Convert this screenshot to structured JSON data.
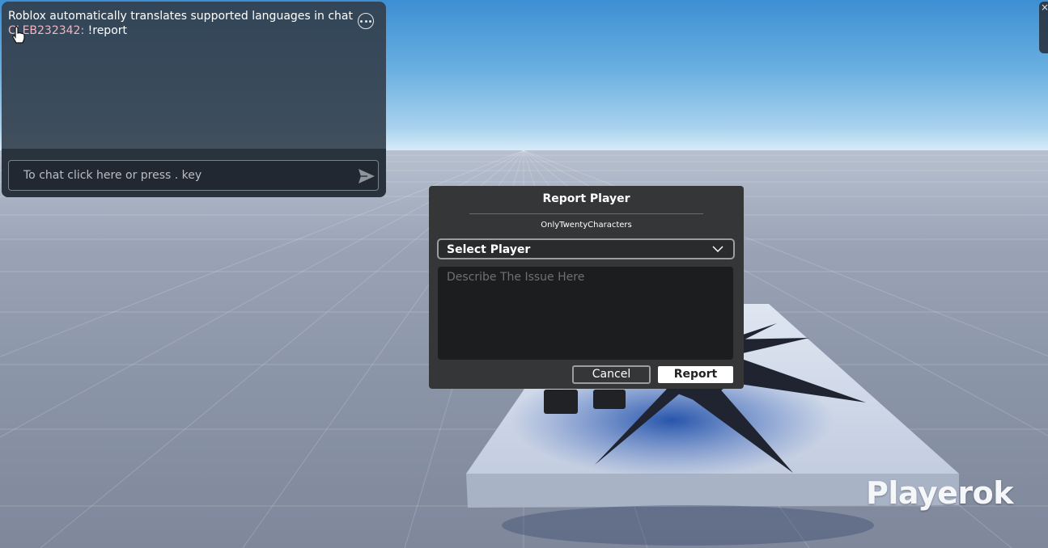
{
  "scene": {
    "sky_color": "#68aee0",
    "floor_color": "#8a94a7",
    "watermark": "Playerok"
  },
  "chat": {
    "lines": [
      {
        "text": "Roblox automatically translates supported languages in chat"
      },
      {
        "name": "CLEB232342:",
        "message": " !report"
      }
    ],
    "input_placeholder": "To chat click here or press . key",
    "icons": {
      "more": "more-options-icon",
      "send": "send-icon",
      "cursor": "hand-cursor-icon"
    }
  },
  "report_dialog": {
    "title": "Report Player",
    "subtitle": "OnlyTwentyCharacters",
    "select_label": "Select Player",
    "issue_placeholder": "Describe The Issue Here",
    "cancel_label": "Cancel",
    "report_label": "Report"
  },
  "corner_button": {
    "icon": "close-icon",
    "label": "×"
  }
}
